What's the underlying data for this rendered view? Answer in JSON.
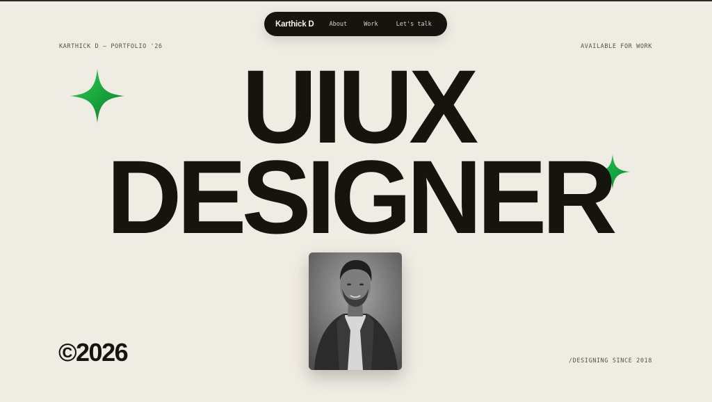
{
  "nav": {
    "brand": "Karthick D",
    "links": [
      "About",
      "Work",
      "Let's talk"
    ]
  },
  "meta": {
    "left": "KARTHICK D — PORTFOLIO '26",
    "right": "AVAILABLE FOR WORK",
    "bottom_right": "/DESIGNING SINCE 2018"
  },
  "hero": {
    "line1": "UIUX",
    "line2": "DESIGNER"
  },
  "footer": {
    "copyright": "©2026"
  },
  "colors": {
    "background": "#efece4",
    "ink": "#16140f",
    "accent_green": "#12a33a"
  },
  "icons": {
    "star_left": "sparkle-star-icon",
    "star_right": "sparkle-star-icon"
  }
}
